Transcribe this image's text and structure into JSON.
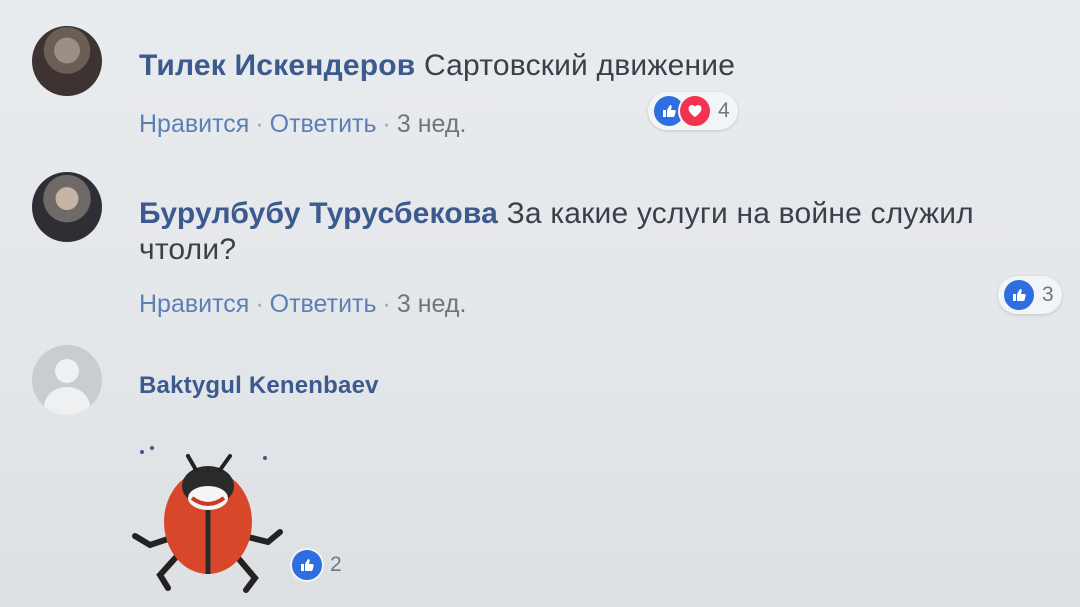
{
  "comments": [
    {
      "author": "Тилек Искендеров",
      "text": "Сартовский движение",
      "actions": {
        "like": "Нравится",
        "reply": "Ответить",
        "time": "3 нед."
      },
      "reactions": {
        "icons": [
          "like-icon",
          "love-icon"
        ],
        "count": "4"
      }
    },
    {
      "author": "Бурулбубу Турусбекова",
      "text": "За какие услуги на войне служил",
      "text_line2": "чтоли?",
      "actions": {
        "like": "Нравится",
        "reply": "Ответить",
        "time": "3 нед."
      },
      "reactions": {
        "icons": [
          "like-icon"
        ],
        "count": "3"
      }
    },
    {
      "author": "Baktygul Kenenbaev",
      "sticker": "ladybug-sticker",
      "reactions": {
        "icons": [
          "like-icon"
        ],
        "count": "2"
      }
    }
  ],
  "colors": {
    "author": "#3d5a8f",
    "action_link": "#5c7fb4",
    "like": "#2f6ee0",
    "love": "#f1334f"
  }
}
